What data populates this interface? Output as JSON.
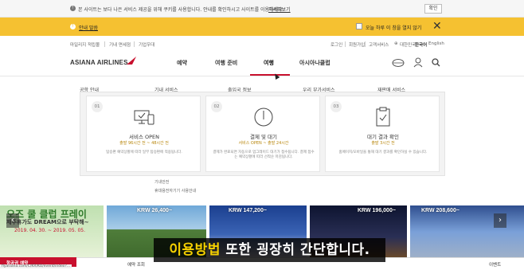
{
  "cookie_bar": {
    "message": "본 사이트는 보다 나은 서비스 제공을 위해 쿠키를 사용합니다. 안내를 확인하시고 사이트를 이용하세요.",
    "more_link": "자세히보기",
    "confirm_button": "확인"
  },
  "notice_bar": {
    "notice_text": "안내 말씀",
    "checkbox_label": "오늘 하루 이 창을 열지 않기",
    "close_icon": "close-icon"
  },
  "utility_bar": {
    "left_links": [
      "마일리지 적립몰",
      "기내 면세점",
      "기업우대"
    ],
    "right_links": [
      "로그인",
      "회원가입",
      "고객서비스"
    ],
    "region": "대한민국",
    "languages": [
      "한국어",
      "English"
    ]
  },
  "header": {
    "logo_text": "ASIANA AIRLINES",
    "nav": [
      "예약",
      "여행 준비",
      "여행",
      "아시아나클럽"
    ],
    "active_nav_index": 2,
    "icons": [
      "globe-icon",
      "user-icon",
      "search-icon"
    ]
  },
  "background_submenu": [
    "공항 안내",
    "기내 서비스",
    "출입국 정보",
    "우리 부가서비스",
    "재판매 서비스"
  ],
  "dropdown": {
    "cards": [
      {
        "num": "01",
        "icon": "devices-icon",
        "title": "서비스 OPEN",
        "sub": "출발 96시간 전 ~ 48시간 전",
        "desc": "탑승편 예약상황에 따라 일부 탑승편에 적용됩니다."
      },
      {
        "num": "02",
        "icon": "clock-icon",
        "title": "결제 및 대기",
        "sub": "서비스 OPEN ~ 출발 24시간",
        "desc": "결제가 완료되면 자동으로 업그레이드 대기가 접수됩니다. 결제 접수는 예약상황에 따라 선착순 마감됩니다."
      },
      {
        "num": "03",
        "icon": "clipboard-check-icon",
        "title": "대기 결과 확인",
        "sub": "출발 3시간 전",
        "desc": "홈페이지/모바일을 통해 대기 결과를 확인하실 수 있습니다."
      }
    ],
    "below_links": [
      "기내안전",
      "휴대용전자기기 사용안내"
    ]
  },
  "banners": [
    {
      "label": "오즈 쿨 클럽 프레이",
      "sub": "제주휴가도 DREAM으로 부탁해~",
      "dates": "2019. 04. 30. ~ 2019. 05. 05."
    },
    {
      "price": "KRW 26,400~"
    },
    {
      "price": "KRW 147,200~"
    },
    {
      "price": "KRW 196,000~"
    },
    {
      "price": "KRW 208,600~"
    }
  ],
  "bottom_bar": {
    "red_label": "항공권 예약",
    "items": [
      "예약 조회",
      "이벤트"
    ],
    "status_url": "flyasiana.com/C/KR/KO/event/index?..."
  },
  "subtitle": {
    "highlight": "이용방법",
    "rest": " 또한 굉장히 간단합니다."
  },
  "colors": {
    "brand_red": "#c8102e",
    "notice_yellow": "#f5c131",
    "subtitle_highlight": "#f5d000"
  }
}
